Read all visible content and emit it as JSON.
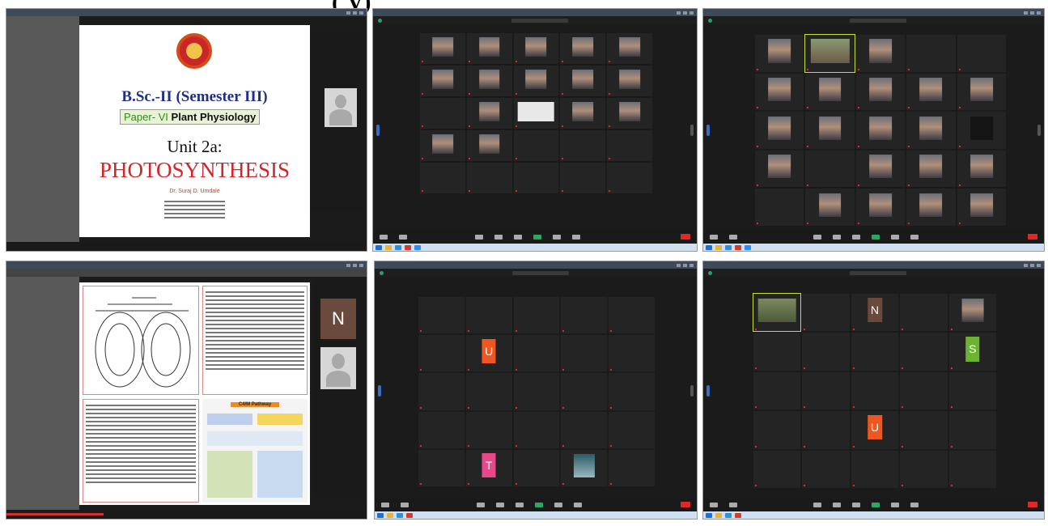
{
  "heading_fragment": "( y)",
  "slide1": {
    "course": "B.Sc.-II (Semester III)",
    "paper_prefix": "Paper- VI",
    "paper_title": "Plant Physiology",
    "unit": "Unit 2a:",
    "topic": "PHOTOSYNTHESIS",
    "author": "Dr. Suraj D. Umdale"
  },
  "slide2": {
    "avatar_letter": "N",
    "table_title": "C4/M Pathway"
  },
  "colors": {
    "title_blue": "#1f2f86",
    "topic_red": "#d0262a",
    "zoom_dark": "#1b1b1b",
    "end_red": "#e02828",
    "avatar_brown": "#6a4a3c",
    "tile_orange": "#f0561f",
    "tile_green": "#6ab42f",
    "tile_pink": "#e8478a"
  }
}
